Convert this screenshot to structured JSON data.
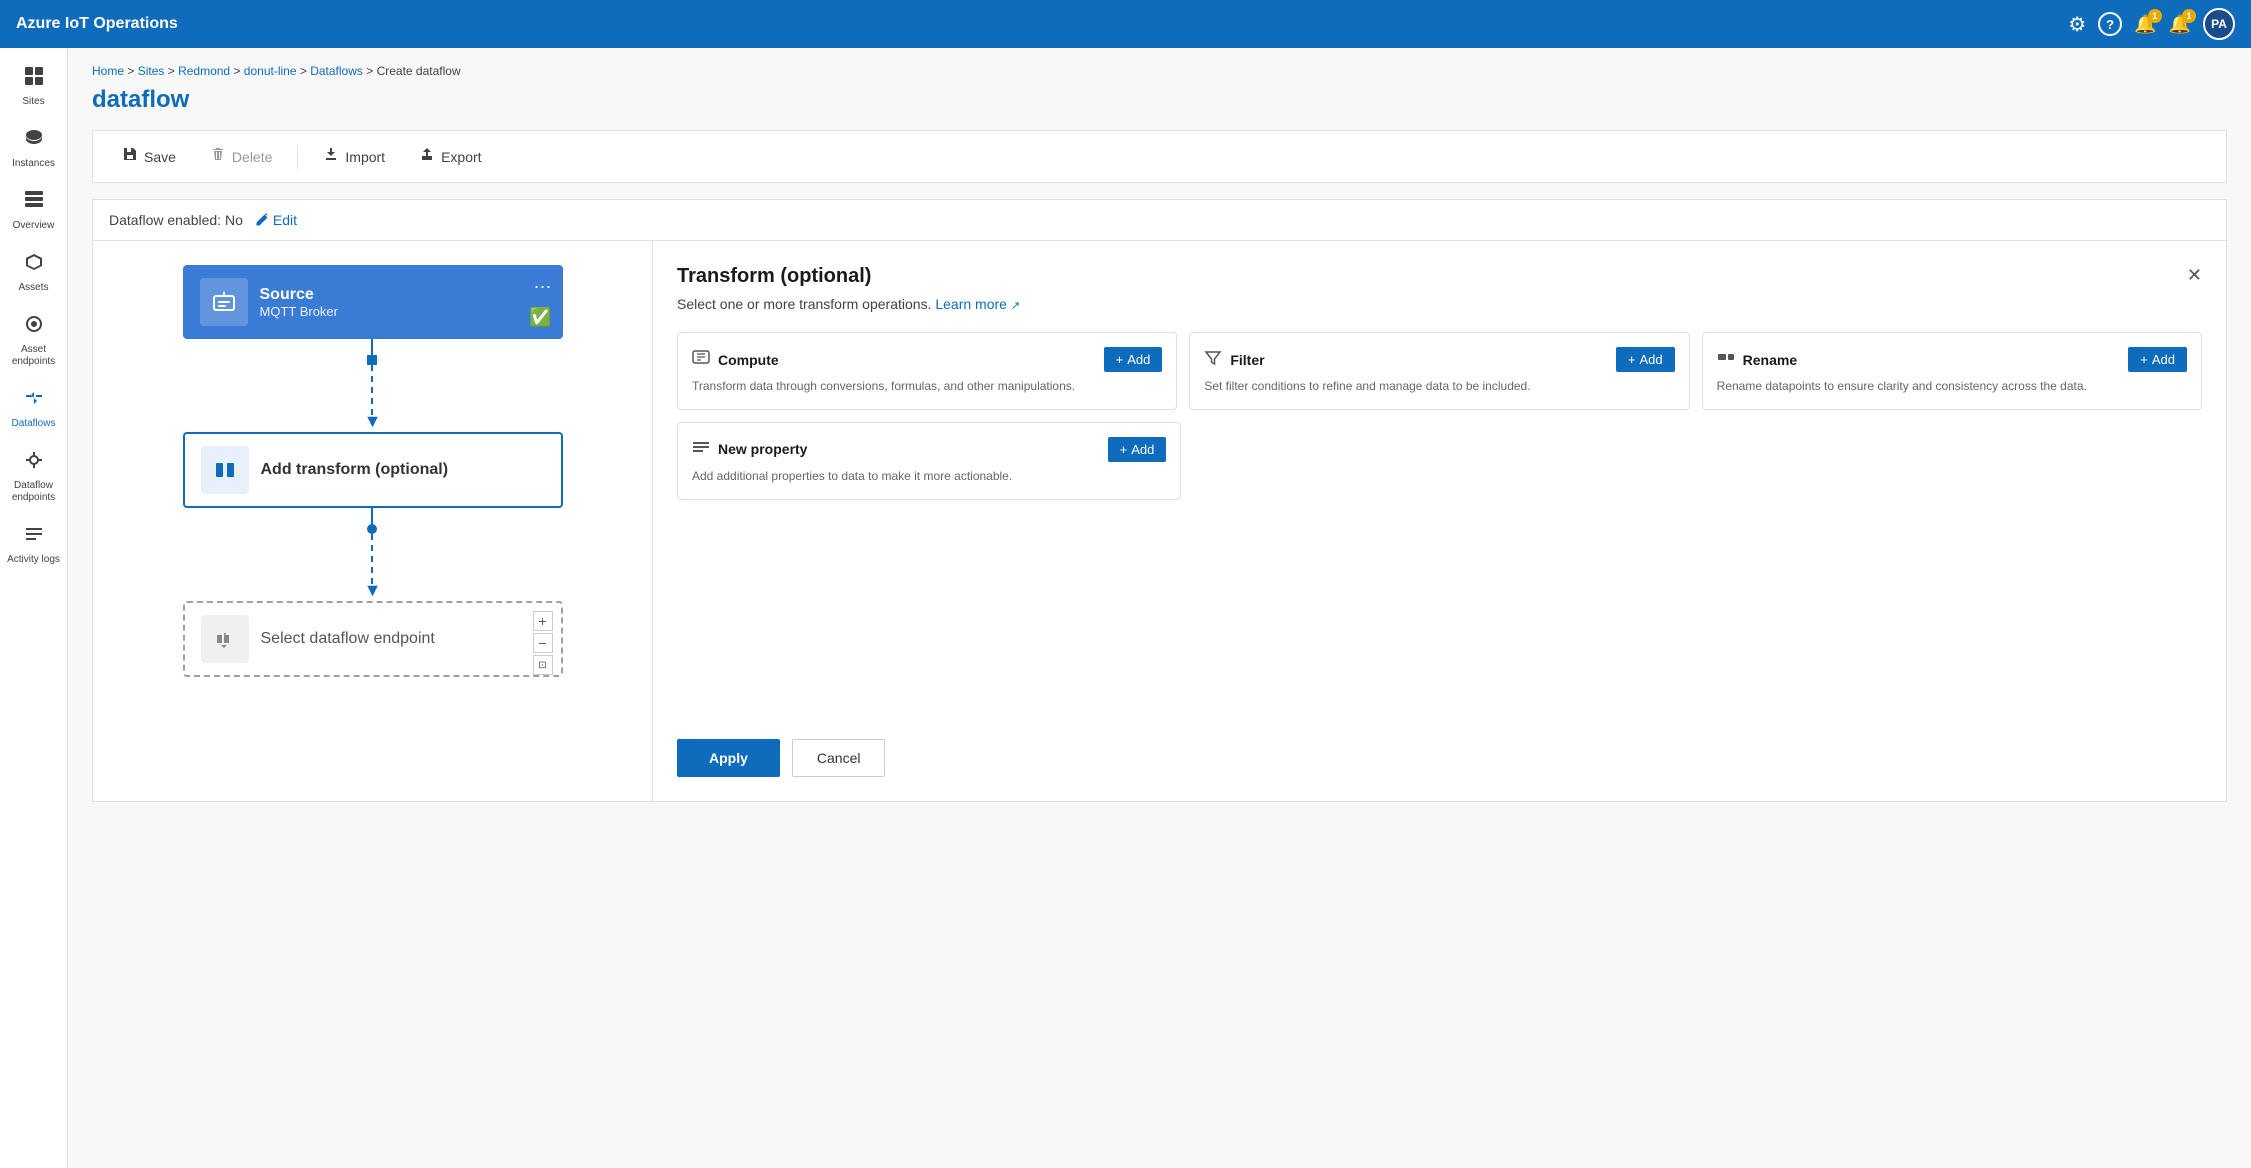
{
  "app": {
    "title": "Azure IoT Operations"
  },
  "topnav": {
    "title": "Azure IoT Operations",
    "icons": {
      "settings": "⚙",
      "help": "?",
      "bell1_count": "1",
      "bell2_count": "1",
      "avatar": "PA"
    }
  },
  "sidebar": {
    "items": [
      {
        "id": "sites",
        "label": "Sites",
        "icon": "⊞"
      },
      {
        "id": "instances",
        "label": "Instances",
        "icon": "☁"
      },
      {
        "id": "overview",
        "label": "Overview",
        "icon": "⊟"
      },
      {
        "id": "assets",
        "label": "Assets",
        "icon": "◈"
      },
      {
        "id": "asset-endpoints",
        "label": "Asset endpoints",
        "icon": "◉"
      },
      {
        "id": "dataflows",
        "label": "Dataflows",
        "icon": "⇄",
        "active": true
      },
      {
        "id": "dataflow-endpoints",
        "label": "Dataflow endpoints",
        "icon": "⊕"
      },
      {
        "id": "activity-logs",
        "label": "Activity logs",
        "icon": "≡"
      }
    ]
  },
  "breadcrumb": {
    "parts": [
      "Home",
      "Sites",
      "Redmond",
      "donut-line",
      "Dataflows",
      "Create dataflow"
    ]
  },
  "page": {
    "title": "dataflow"
  },
  "toolbar": {
    "save_label": "Save",
    "delete_label": "Delete",
    "import_label": "Import",
    "export_label": "Export"
  },
  "dataflow": {
    "status_label": "Dataflow enabled: No",
    "edit_label": "Edit",
    "nodes": {
      "source": {
        "title": "Source",
        "subtitle": "MQTT Broker",
        "menu": "···"
      },
      "transform": {
        "title": "Add transform (optional)"
      },
      "destination": {
        "title": "Select dataflow endpoint"
      }
    }
  },
  "transform_panel": {
    "title": "Transform (optional)",
    "subtitle": "Select one or more transform operations.",
    "learn_more": "Learn more",
    "close_label": "×",
    "cards": [
      {
        "id": "compute",
        "icon": "⊞",
        "title": "Compute",
        "description": "Transform data through conversions, formulas, and other manipulations.",
        "add_label": "+ Add"
      },
      {
        "id": "filter",
        "icon": "⊟",
        "title": "Filter",
        "description": "Set filter conditions to refine and manage data to be included.",
        "add_label": "+ Add"
      },
      {
        "id": "rename",
        "icon": "⊠",
        "title": "Rename",
        "description": "Rename datapoints to ensure clarity and consistency across the data.",
        "add_label": "+ Add"
      },
      {
        "id": "new-property",
        "icon": "☰",
        "title": "New property",
        "description": "Add additional properties to data to make it more actionable.",
        "add_label": "+ Add"
      }
    ],
    "apply_label": "Apply",
    "cancel_label": "Cancel"
  }
}
